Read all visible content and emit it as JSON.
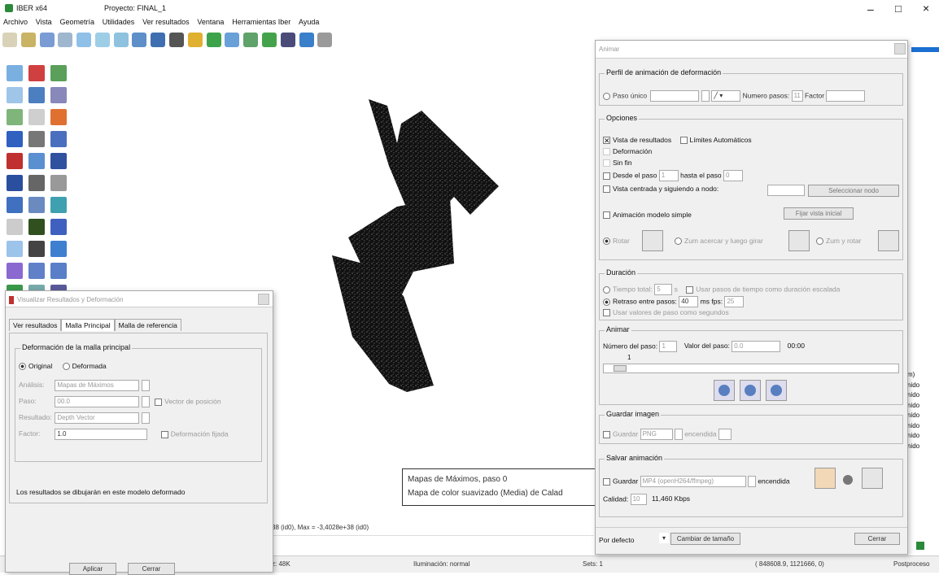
{
  "app": {
    "name": "IBER x64",
    "project": "Proyecto: FINAL_1"
  },
  "menu": [
    "Archivo",
    "Vista",
    "Geometría",
    "Utilidades",
    "Ver resultados",
    "Ventana",
    "Herramientas Iber",
    "Ayuda"
  ],
  "window_controls": {
    "minimize": "–",
    "maximize": "□",
    "close": "×"
  },
  "legend_box": {
    "line1": "Mapas de Máximos, paso 0",
    "line2": "Mapa de color suavizado (Media) de Calad"
  },
  "range_text": "38 (id0), Max = -3,4028e+38 (id0)",
  "right_list": [
    "m)",
    "nido",
    "nido",
    "nido",
    "nido",
    "nido",
    "nido",
    "nido"
  ],
  "statusbar": {
    "zoom": "z: 48K",
    "illumination": "Iluminación: normal",
    "sets": "Sets: 1",
    "coords": "( 848608.9, 1121666, 0)",
    "prep": "Postproceso"
  },
  "anim": {
    "title": "Animar",
    "g1": "Perfil de animación de deformación",
    "paso_unico": "Paso único",
    "numero_pasos": "Numero pasos:",
    "numero_pasos_val": "11",
    "factor": "Factor",
    "g2": "Opciones",
    "vista_resultados": "Vista de resultados",
    "limites_auto": "Límites Automáticos",
    "deformacion": "Deformación",
    "sin_fin": "Sin fin",
    "desde_paso": "Desde el paso",
    "desde_val": "1",
    "hasta_paso": "hasta el paso",
    "hasta_val": "0",
    "vista_centrada": "Vista centrada y siguiendo a nodo:",
    "seleccionar_nodo": "Seleccionar nodo",
    "animacion_simple": "Animación modelo simple",
    "fijar_vista": "Fijar vista inicial",
    "rotar": "Rotar",
    "zoom_acercar": "Zum acercar y luego girar",
    "zoom_rotar": "Zum y rotar",
    "g3": "Duración",
    "tiempo_total": "Tiempo total:",
    "tiempo_val": "5",
    "s": "s",
    "usar_pasos": "Usar pasos de tiempo como duración escalada",
    "retraso": "Retraso entre pasos:",
    "retraso_val": "40",
    "ms": "ms",
    "fps_label": "fps:",
    "fps_val": "25",
    "usar_valores": "Usar valores de paso como segundos",
    "g4": "Animar",
    "num_paso": "Número del paso:",
    "num_paso_val": "1",
    "valor_paso": "Valor del paso:",
    "valor_val": "0.0",
    "valor_time": "00:00",
    "slider_mark": "1",
    "g5": "Guardar imagen",
    "guardar": "Guardar",
    "guardar_fmt": "PNG",
    "encendida": "encendida",
    "g6": "Salvar animación",
    "guardar2": "Guardar",
    "anim_fmt": "MP4 (openH264/ffmpeg)",
    "encendida2": "encendida",
    "calidad": "Calidad:",
    "calidad_val": "10",
    "kbps": "11,460 Kbps",
    "por_defecto": "Por defecto",
    "cambiar_tam": "Cambiar de tamaño",
    "cerrar": "Cerrar"
  },
  "viz": {
    "title": "Visualizar Resultados y Deformación",
    "tabs": [
      "Ver resultados",
      "Malla Principal",
      "Malla de referencia"
    ],
    "group": "Deformación de la malla principal",
    "original": "Original",
    "deformada": "Deformada",
    "analisis_l": "Análisis:",
    "analisis_v": "Mapas de Máximos",
    "paso_l": "Paso:",
    "paso_v": "00.0",
    "vector_pos": "Vector de posición",
    "resultado_l": "Resultado:",
    "resultado_v": "Depth Vector",
    "factor_l": "Factor:",
    "factor_v": "1.0",
    "def_fijada": "Deformación fijada",
    "note": "Los resultados se dibujarán en este modelo deformado",
    "aplicar": "Aplicar",
    "cerrar": "Cerrar"
  },
  "colors": {
    "accent": "#1a6fd1",
    "panel": "#f0f0f0"
  }
}
